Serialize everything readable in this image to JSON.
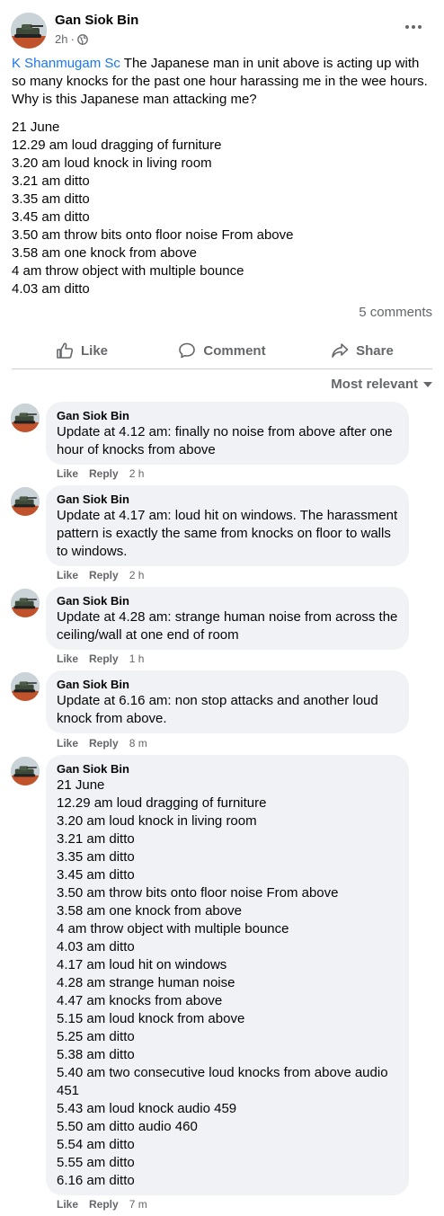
{
  "post": {
    "author": "Gan Siok Bin",
    "time": "2h",
    "more_icon": "more-horizontal-icon",
    "mention": "K Shanmugam Sc",
    "intro": " The Japanese man in unit above is acting up with so many knocks for the past one hour harassing me in the wee hours. Why is this Japanese man attacking me?",
    "lines": [
      "21 June",
      "12.29 am loud dragging of furniture",
      "3.20 am loud knock in living room",
      "3.21 am ditto",
      "3.35 am ditto",
      "3.45 am ditto",
      "3.50 am throw bits onto floor noise From above",
      "3.58 am one knock from above",
      "4 am throw object with multiple bounce",
      "4.03 am ditto"
    ],
    "comment_count": "5 comments"
  },
  "actions": {
    "like": "Like",
    "comment": "Comment",
    "share": "Share"
  },
  "sort_label": "Most relevant",
  "comment_action_labels": {
    "like": "Like",
    "reply": "Reply"
  },
  "comments": [
    {
      "author": "Gan Siok Bin",
      "lines": [
        "Update at 4.12 am: finally no noise from above after one hour of knocks from above"
      ],
      "time": "2 h"
    },
    {
      "author": "Gan Siok Bin",
      "lines": [
        "Update at 4.17 am: loud hit on windows. The harassment pattern is exactly the same from knocks on floor to walls to windows."
      ],
      "time": "2 h"
    },
    {
      "author": "Gan Siok Bin",
      "lines": [
        "Update at 4.28 am: strange human noise from across the ceiling/wall at one end of room"
      ],
      "time": "1 h"
    },
    {
      "author": "Gan Siok Bin",
      "lines": [
        "Update at 6.16 am: non stop attacks and another loud knock from above."
      ],
      "time": "8 m"
    },
    {
      "author": "Gan Siok Bin",
      "lines": [
        "21 June",
        "12.29 am loud dragging of furniture",
        "3.20 am loud knock in living room",
        "3.21 am ditto",
        "3.35 am ditto",
        "3.45 am ditto",
        "3.50 am throw bits onto floor noise From above",
        "3.58 am one knock from above",
        "4 am throw object with multiple bounce",
        "4.03 am ditto",
        "4.17 am loud hit on windows",
        "4.28 am strange human noise",
        "4.47 am knocks from above",
        "5.15 am loud knock from above",
        "5.25 am ditto",
        "5.38 am ditto",
        "5.40 am two consecutive loud knocks from above audio 451",
        "5.43 am loud knock audio 459",
        "5.50 am ditto audio 460",
        "5.54 am ditto",
        "5.55 am ditto",
        "6.16 am ditto"
      ],
      "time": "7 m"
    }
  ],
  "colors": {
    "link": "#1877f2",
    "secondary_text": "#65676b",
    "bubble": "#f0f2f5"
  }
}
